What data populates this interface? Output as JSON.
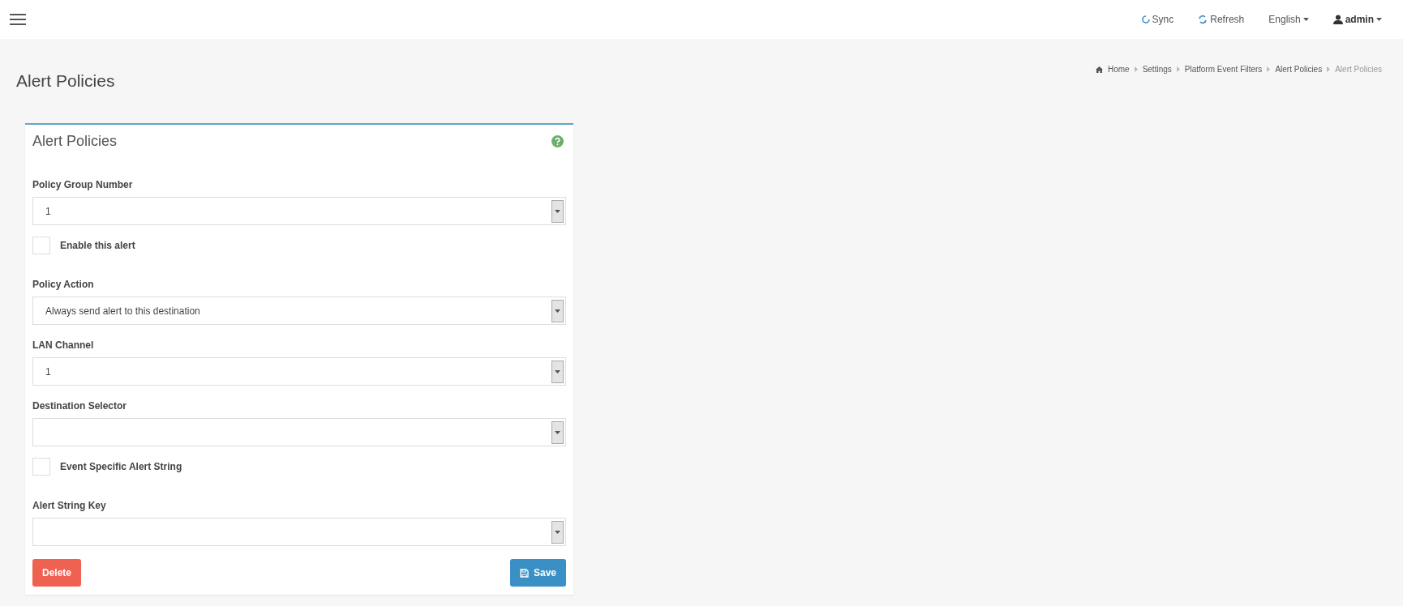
{
  "topbar": {
    "items": [
      {
        "kind": "sync",
        "label": "Sync"
      },
      {
        "kind": "refresh",
        "label": "Refresh"
      },
      {
        "kind": "language",
        "label": "English"
      },
      {
        "kind": "user",
        "label": "admin"
      }
    ]
  },
  "breadcrumb": [
    {
      "label": "Home",
      "current": false
    },
    {
      "label": "Settings",
      "current": false
    },
    {
      "label": "Platform Event Filters",
      "current": false
    },
    {
      "label": "Alert Policies",
      "current": false
    },
    {
      "label": "Alert Policies",
      "current": true
    }
  ],
  "page_title": "Alert Policies",
  "card": {
    "title": "Alert Policies",
    "fields": [
      {
        "kind": "select",
        "label": "Policy Group Number",
        "value": "1"
      },
      {
        "kind": "checkbox",
        "label": "Enable this alert",
        "checked": false
      },
      {
        "kind": "select",
        "label": "Policy Action",
        "value": "Always send alert to this destination"
      },
      {
        "kind": "select",
        "label": "LAN Channel",
        "value": "1"
      },
      {
        "kind": "select",
        "label": "Destination Selector"
      },
      {
        "kind": "checkbox",
        "label": "Event Specific Alert String",
        "checked": false
      },
      {
        "kind": "select",
        "label": "Alert String Key"
      }
    ],
    "buttons": [
      {
        "kind": "delete",
        "label": "Delete"
      },
      {
        "kind": "save",
        "label": "Save"
      }
    ]
  }
}
